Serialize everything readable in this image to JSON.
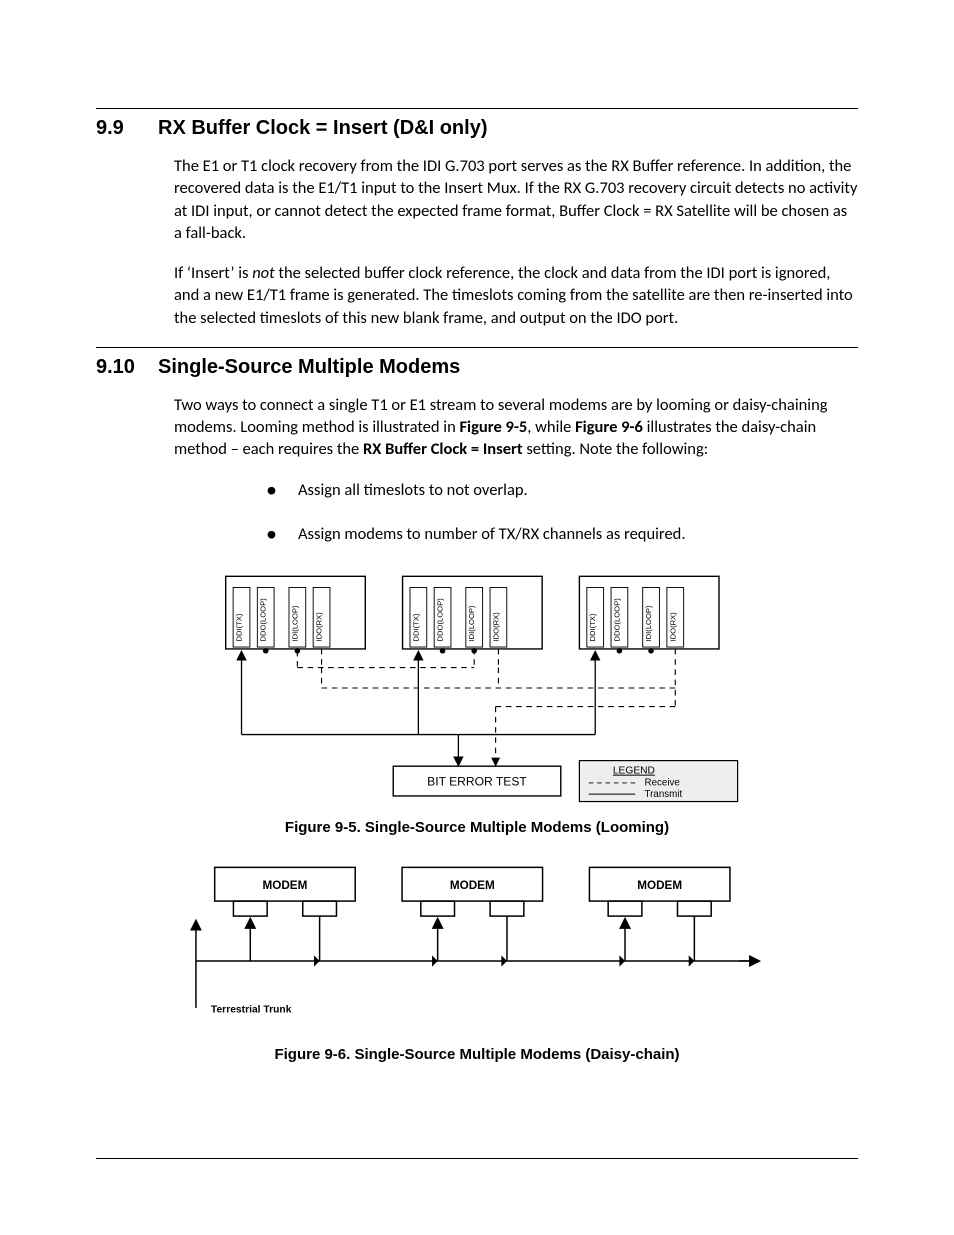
{
  "section_9_9": {
    "num": "9.9",
    "title": "RX Buffer Clock = Insert (D&I only)",
    "para1": "The E1 or T1 clock recovery from the IDI G.703 port serves as the RX Buffer reference. In addition, the recovered data is the E1/T1 input to the Insert Mux. If the RX G.703 recovery circuit detects no activity at IDI input, or cannot detect the expected frame format, Buffer Clock = RX Satellite will be chosen as a fall-back.",
    "para2_pre": "If ‘Insert’ is ",
    "para2_em": "not",
    "para2_post": " the selected buffer clock reference, the clock and data from the IDI port is ignored, and a new E1/T1 frame is generated. The timeslots coming from the satellite are then re-inserted into the selected timeslots of this new blank frame, and output on the IDO port."
  },
  "section_9_10": {
    "num": "9.10",
    "title": "Single-Source Multiple Modems",
    "para_pre": "Two ways to connect a single T1 or E1 stream to several modems are by looming or daisy-chaining modems. Looming method is illustrated in ",
    "ref1": "Figure 9-5",
    "para_mid": ", while ",
    "ref2": "Figure 9-6",
    "para_post1": " illustrates the daisy-chain method – each requires the ",
    "bold_setting": "RX Buffer Clock = Insert",
    "para_post2": " setting. Note the following:",
    "bullets": [
      "Assign all timeslots to not overlap.",
      "Assign modems to number of TX/RX channels as required."
    ]
  },
  "figure95": {
    "caption": "Figure 9-5. Single-Source Multiple Modems (Looming)",
    "port_labels": [
      "DDI(TX)",
      "DDO(LOOP)",
      "IDI(LOOP)",
      "IDO(RX)"
    ],
    "box_label": "BIT ERROR TEST",
    "legend_title": "LEGEND",
    "legend_receive": "Receive",
    "legend_transmit": "Transmit"
  },
  "figure96": {
    "caption": "Figure 9-6. Single-Source Multiple Modems (Daisy-chain)",
    "modem_label": "MODEM",
    "trunk_label": "Terrestrial Trunk"
  }
}
